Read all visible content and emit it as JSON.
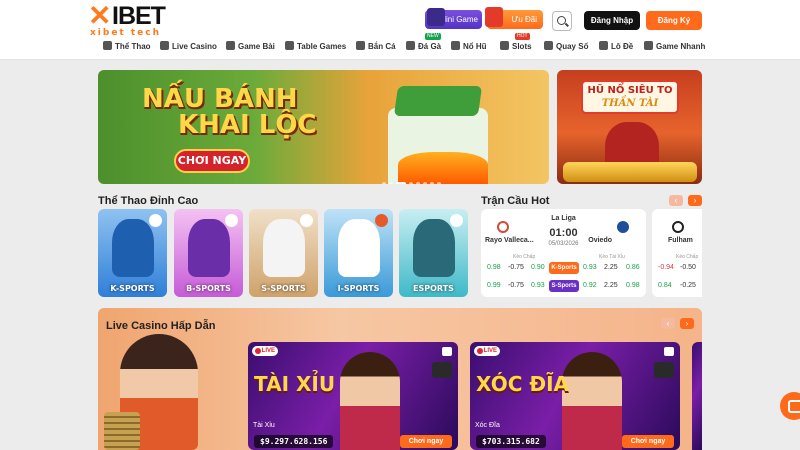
{
  "header": {
    "logo_text": "XIBET",
    "logo_sub": "xibet tech",
    "mini_game": "Mini Game",
    "uu_dai": "Ưu Đãi",
    "login": "Đăng Nhập",
    "register": "Đăng Ký"
  },
  "nav": [
    {
      "label": "Thể Thao",
      "icon": "soccer-icon",
      "badge": ""
    },
    {
      "label": "Live Casino",
      "icon": "casino-icon",
      "badge": ""
    },
    {
      "label": "Game Bài",
      "icon": "cards-icon",
      "badge": ""
    },
    {
      "label": "Table Games",
      "icon": "table-icon",
      "badge": ""
    },
    {
      "label": "Bắn Cá",
      "icon": "fish-icon",
      "badge": ""
    },
    {
      "label": "Đá Gà",
      "icon": "rooster-icon",
      "badge": "NEW"
    },
    {
      "label": "Nổ Hũ",
      "icon": "jackpot-icon",
      "badge": ""
    },
    {
      "label": "Slots",
      "icon": "slots-icon",
      "badge": "HOT"
    },
    {
      "label": "Quay Số",
      "icon": "lottery-wheel-icon",
      "badge": ""
    },
    {
      "label": "Lô Đề",
      "icon": "lotto-icon",
      "badge": ""
    },
    {
      "label": "Game Nhanh",
      "icon": "rocket-icon",
      "badge": ""
    }
  ],
  "banner_main": {
    "line1": "NẤU BÁNH",
    "line2": "KHAI LỘC",
    "cta": "CHƠI NGAY"
  },
  "banner_side": {
    "line1": "HŨ NỔ SIÊU TO",
    "line2": "THẦN TÀI"
  },
  "sports_section": {
    "title": "Thể Thao Đỉnh Cao",
    "cards": [
      {
        "label": "K-SPORTS",
        "bg": "#2f7fd8"
      },
      {
        "label": "B-SPORTS",
        "bg": "#c65bd8"
      },
      {
        "label": "S-SPORTS",
        "bg": "#cfa26a"
      },
      {
        "label": "I-SPORTS",
        "bg": "#3a9ad8"
      },
      {
        "label": "ESPORTS",
        "bg": "#3fb9c8"
      }
    ]
  },
  "hot_section": {
    "title": "Trận Cầu Hot",
    "match": {
      "league": "La Liga",
      "time": "01:00",
      "date": "05/03/2026",
      "home": "Rayo Valleca...",
      "away": "Oviedo",
      "hdr_left": "Kèo Chấp",
      "hdr_right": "Kèo Tài Xỉu",
      "row1": [
        "0.98",
        "-0.75",
        "0.90",
        "0.93",
        "2.25",
        "0.86"
      ],
      "row2": [
        "0.99",
        "-0.75",
        "0.93",
        "0.92",
        "2.25",
        "0.98"
      ],
      "prov1": "K-Sports",
      "prov2": "S-Sports"
    },
    "match2": {
      "home": "Fulham",
      "hdr_left": "Kèo Chấp",
      "row1": [
        "-0.94",
        "-0.50"
      ],
      "row2": [
        "0.84",
        "-0.25"
      ]
    }
  },
  "casino_section": {
    "title": "Live Casino Hấp Dẫn",
    "live_label": "LIVE",
    "games": [
      {
        "title": "TÀI XỈU",
        "name": "Tài Xỉu",
        "amount": "$9.297.628.156",
        "cta": "Chơi ngay"
      },
      {
        "title": "XÓC ĐĨA",
        "name": "Xóc Đĩa",
        "amount": "$703.315.682",
        "cta": "Chơi ngay"
      }
    ]
  },
  "colors": {
    "accent": "#ff6b1a",
    "dark": "#111111",
    "purple": "#6a2fc4"
  }
}
